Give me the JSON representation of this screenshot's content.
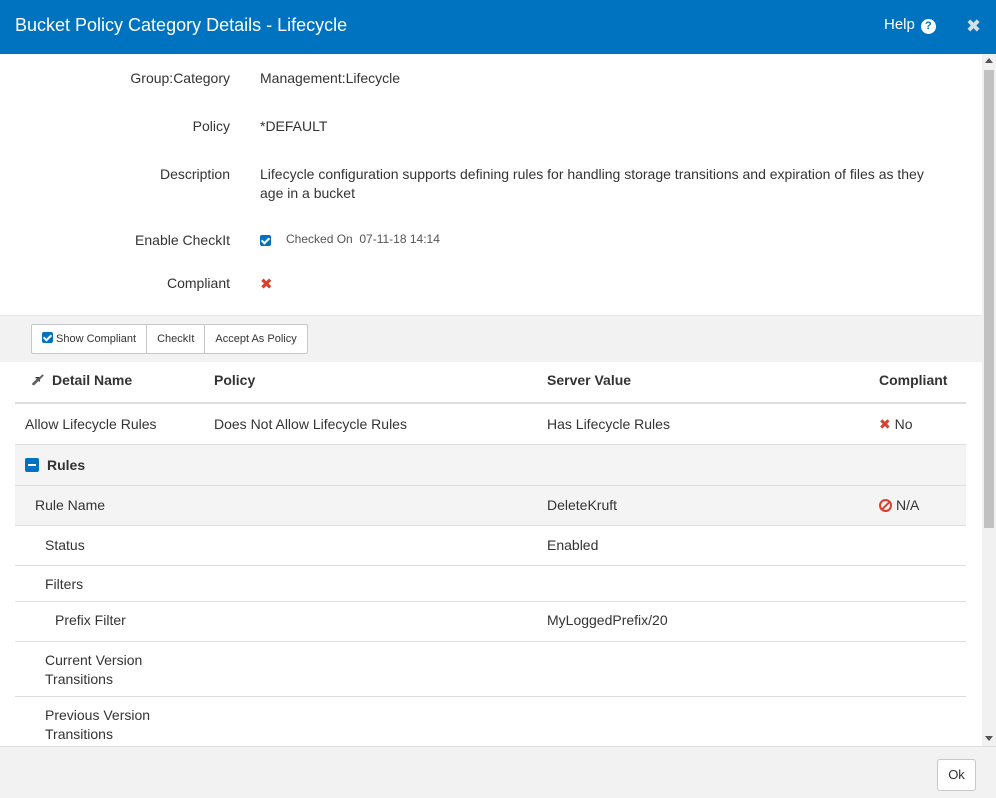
{
  "dialog": {
    "title": "Bucket Policy Category Details - Lifecycle",
    "help_label": "Help",
    "help_icon": "?",
    "close_icon": "✖"
  },
  "details": {
    "group_category_label": "Group:Category",
    "group_category_value": "Management:Lifecycle",
    "policy_label": "Policy",
    "policy_value": "*DEFAULT",
    "description_label": "Description",
    "description_value": "Lifecycle configuration supports defining rules for handling storage transitions and expiration of files as they age in a bucket",
    "enable_checkit_label": "Enable CheckIt",
    "checked_on_label": "Checked On",
    "checked_on_value": "07-11-18 14:14",
    "compliant_label": "Compliant",
    "compliant_icon": "✖"
  },
  "toolbar": {
    "show_compliant_label": "Show Compliant",
    "checkit_label": "CheckIt",
    "accept_label": "Accept As Policy"
  },
  "table": {
    "headers": {
      "detail_name": "Detail Name",
      "policy": "Policy",
      "server_value": "Server Value",
      "compliant": "Compliant"
    },
    "rows": [
      {
        "name": "Allow Lifecycle Rules",
        "policy": "Does Not Allow Lifecycle Rules",
        "server": "Has Lifecycle Rules",
        "compliant": "No"
      },
      {
        "name": "Rules",
        "policy": "",
        "server": "",
        "compliant": ""
      },
      {
        "name": "Rule Name",
        "policy": "",
        "server": "DeleteKruft",
        "compliant": "N/A"
      },
      {
        "name": "Status",
        "policy": "",
        "server": "Enabled",
        "compliant": ""
      },
      {
        "name": "Filters",
        "policy": "",
        "server": "",
        "compliant": ""
      },
      {
        "name": "Prefix Filter",
        "policy": "",
        "server": "MyLoggedPrefix/20",
        "compliant": ""
      },
      {
        "name": "Current Version\nTransitions",
        "policy": "",
        "server": "",
        "compliant": ""
      },
      {
        "name": "Previous Version\nTransitions",
        "policy": "",
        "server": "",
        "compliant": ""
      }
    ],
    "row_compliant_icon": "✖"
  },
  "footer": {
    "ok_label": "Ok"
  },
  "colors": {
    "accent": "#0073c0",
    "error": "#d9402f"
  }
}
